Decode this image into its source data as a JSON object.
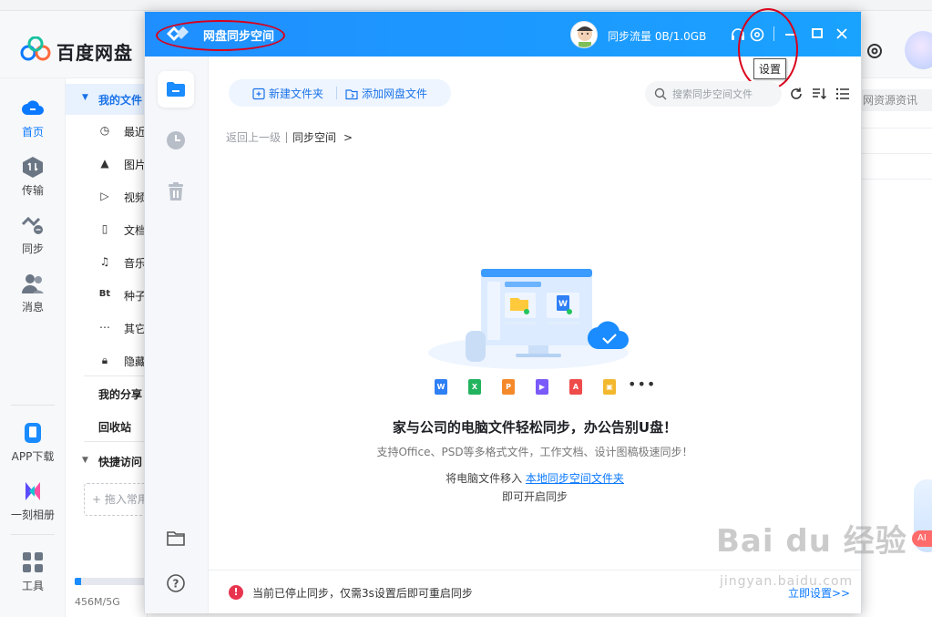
{
  "background": {
    "brand_name": "百度网盘",
    "nav": [
      {
        "label": "首页",
        "icon": "cloud-icon"
      },
      {
        "label": "传输",
        "icon": "transfer-icon"
      },
      {
        "label": "同步",
        "icon": "sync-icon"
      },
      {
        "label": "消息",
        "icon": "message-icon"
      },
      {
        "label": "APP下载",
        "icon": "phone-icon"
      },
      {
        "label": "一刻相册",
        "icon": "album-icon"
      },
      {
        "label": "工具",
        "icon": "tools-icon"
      }
    ],
    "tree": {
      "my_files": "我的文件",
      "items": [
        "最近",
        "图片",
        "视频",
        "文档",
        "音乐",
        "种子",
        "其它",
        "隐藏"
      ],
      "my_share": "我的分享",
      "recycle_bin": "回收站",
      "quick_access": "快捷访问",
      "quick_add": "+ 拖入常用"
    },
    "storage": {
      "text": "456M/5G",
      "used_fraction": 0.09
    },
    "resource_label": "网资源资讯",
    "mascot_label": "AI"
  },
  "sync_window": {
    "title": "网盘同步空间",
    "traffic": "同步流量  0B/1.0GB",
    "tooltip": "设置",
    "toolbar": {
      "new_folder": "新建文件夹",
      "add_files": "添加网盘文件",
      "search_placeholder": "搜索同步空间文件"
    },
    "breadcrumb": {
      "back": "返回上一级",
      "current": "同步空间",
      "chevron": ">"
    },
    "file_types": [
      {
        "label": "W",
        "color": "#2f7ff5"
      },
      {
        "label": "X",
        "color": "#22b35e"
      },
      {
        "label": "P",
        "color": "#f5892a"
      },
      {
        "label": "▶",
        "color": "#7a5af8"
      },
      {
        "label": "A",
        "color": "#ef4b4b"
      },
      {
        "label": "▣",
        "color": "#f3b82e"
      }
    ],
    "more": "•••",
    "empty": {
      "title": "家与公司的电脑文件轻松同步，办公告别U盘！",
      "subtitle": "支持Office、PSD等多格式文件，工作文档、设计图稿极速同步！",
      "move_prefix": "将电脑文件移入",
      "move_link": "本地同步空间文件夹",
      "start": "即可开启同步"
    },
    "footer": {
      "warning": "当前已停止同步，仅需3s设置后即可重启同步",
      "setup_link": "立即设置>>"
    }
  },
  "watermark": {
    "main": "Bai du 经验",
    "sub": "jingyan.baidu.com"
  }
}
